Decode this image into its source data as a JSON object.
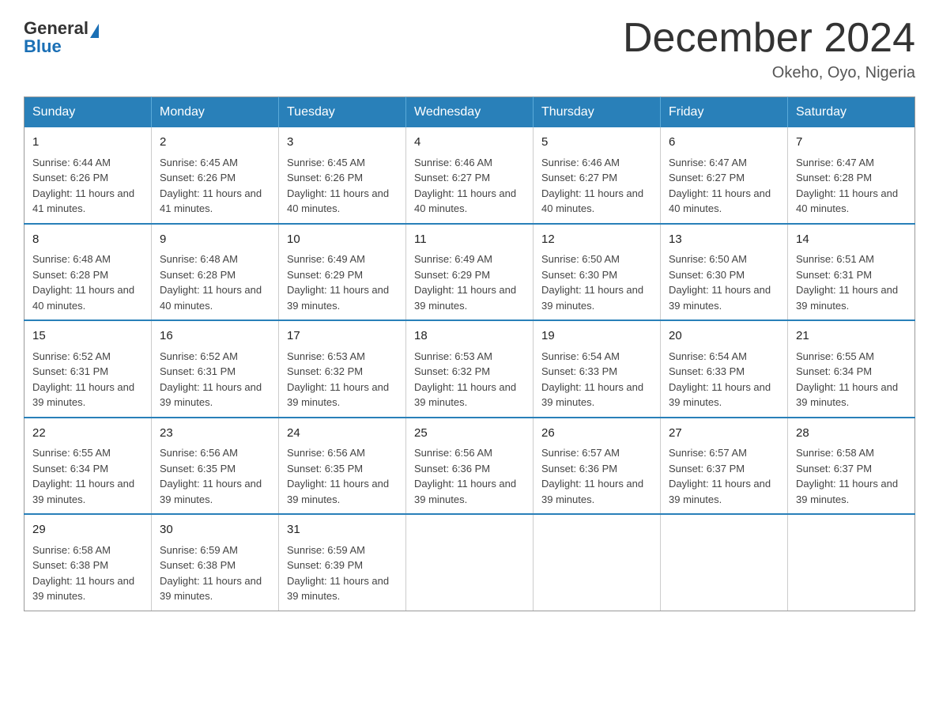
{
  "logo": {
    "general": "General",
    "blue": "Blue"
  },
  "title": "December 2024",
  "subtitle": "Okeho, Oyo, Nigeria",
  "headers": [
    "Sunday",
    "Monday",
    "Tuesday",
    "Wednesday",
    "Thursday",
    "Friday",
    "Saturday"
  ],
  "weeks": [
    [
      {
        "day": "1",
        "sunrise": "6:44 AM",
        "sunset": "6:26 PM",
        "daylight": "11 hours and 41 minutes."
      },
      {
        "day": "2",
        "sunrise": "6:45 AM",
        "sunset": "6:26 PM",
        "daylight": "11 hours and 41 minutes."
      },
      {
        "day": "3",
        "sunrise": "6:45 AM",
        "sunset": "6:26 PM",
        "daylight": "11 hours and 40 minutes."
      },
      {
        "day": "4",
        "sunrise": "6:46 AM",
        "sunset": "6:27 PM",
        "daylight": "11 hours and 40 minutes."
      },
      {
        "day": "5",
        "sunrise": "6:46 AM",
        "sunset": "6:27 PM",
        "daylight": "11 hours and 40 minutes."
      },
      {
        "day": "6",
        "sunrise": "6:47 AM",
        "sunset": "6:27 PM",
        "daylight": "11 hours and 40 minutes."
      },
      {
        "day": "7",
        "sunrise": "6:47 AM",
        "sunset": "6:28 PM",
        "daylight": "11 hours and 40 minutes."
      }
    ],
    [
      {
        "day": "8",
        "sunrise": "6:48 AM",
        "sunset": "6:28 PM",
        "daylight": "11 hours and 40 minutes."
      },
      {
        "day": "9",
        "sunrise": "6:48 AM",
        "sunset": "6:28 PM",
        "daylight": "11 hours and 40 minutes."
      },
      {
        "day": "10",
        "sunrise": "6:49 AM",
        "sunset": "6:29 PM",
        "daylight": "11 hours and 39 minutes."
      },
      {
        "day": "11",
        "sunrise": "6:49 AM",
        "sunset": "6:29 PM",
        "daylight": "11 hours and 39 minutes."
      },
      {
        "day": "12",
        "sunrise": "6:50 AM",
        "sunset": "6:30 PM",
        "daylight": "11 hours and 39 minutes."
      },
      {
        "day": "13",
        "sunrise": "6:50 AM",
        "sunset": "6:30 PM",
        "daylight": "11 hours and 39 minutes."
      },
      {
        "day": "14",
        "sunrise": "6:51 AM",
        "sunset": "6:31 PM",
        "daylight": "11 hours and 39 minutes."
      }
    ],
    [
      {
        "day": "15",
        "sunrise": "6:52 AM",
        "sunset": "6:31 PM",
        "daylight": "11 hours and 39 minutes."
      },
      {
        "day": "16",
        "sunrise": "6:52 AM",
        "sunset": "6:31 PM",
        "daylight": "11 hours and 39 minutes."
      },
      {
        "day": "17",
        "sunrise": "6:53 AM",
        "sunset": "6:32 PM",
        "daylight": "11 hours and 39 minutes."
      },
      {
        "day": "18",
        "sunrise": "6:53 AM",
        "sunset": "6:32 PM",
        "daylight": "11 hours and 39 minutes."
      },
      {
        "day": "19",
        "sunrise": "6:54 AM",
        "sunset": "6:33 PM",
        "daylight": "11 hours and 39 minutes."
      },
      {
        "day": "20",
        "sunrise": "6:54 AM",
        "sunset": "6:33 PM",
        "daylight": "11 hours and 39 minutes."
      },
      {
        "day": "21",
        "sunrise": "6:55 AM",
        "sunset": "6:34 PM",
        "daylight": "11 hours and 39 minutes."
      }
    ],
    [
      {
        "day": "22",
        "sunrise": "6:55 AM",
        "sunset": "6:34 PM",
        "daylight": "11 hours and 39 minutes."
      },
      {
        "day": "23",
        "sunrise": "6:56 AM",
        "sunset": "6:35 PM",
        "daylight": "11 hours and 39 minutes."
      },
      {
        "day": "24",
        "sunrise": "6:56 AM",
        "sunset": "6:35 PM",
        "daylight": "11 hours and 39 minutes."
      },
      {
        "day": "25",
        "sunrise": "6:56 AM",
        "sunset": "6:36 PM",
        "daylight": "11 hours and 39 minutes."
      },
      {
        "day": "26",
        "sunrise": "6:57 AM",
        "sunset": "6:36 PM",
        "daylight": "11 hours and 39 minutes."
      },
      {
        "day": "27",
        "sunrise": "6:57 AM",
        "sunset": "6:37 PM",
        "daylight": "11 hours and 39 minutes."
      },
      {
        "day": "28",
        "sunrise": "6:58 AM",
        "sunset": "6:37 PM",
        "daylight": "11 hours and 39 minutes."
      }
    ],
    [
      {
        "day": "29",
        "sunrise": "6:58 AM",
        "sunset": "6:38 PM",
        "daylight": "11 hours and 39 minutes."
      },
      {
        "day": "30",
        "sunrise": "6:59 AM",
        "sunset": "6:38 PM",
        "daylight": "11 hours and 39 minutes."
      },
      {
        "day": "31",
        "sunrise": "6:59 AM",
        "sunset": "6:39 PM",
        "daylight": "11 hours and 39 minutes."
      },
      null,
      null,
      null,
      null
    ]
  ]
}
